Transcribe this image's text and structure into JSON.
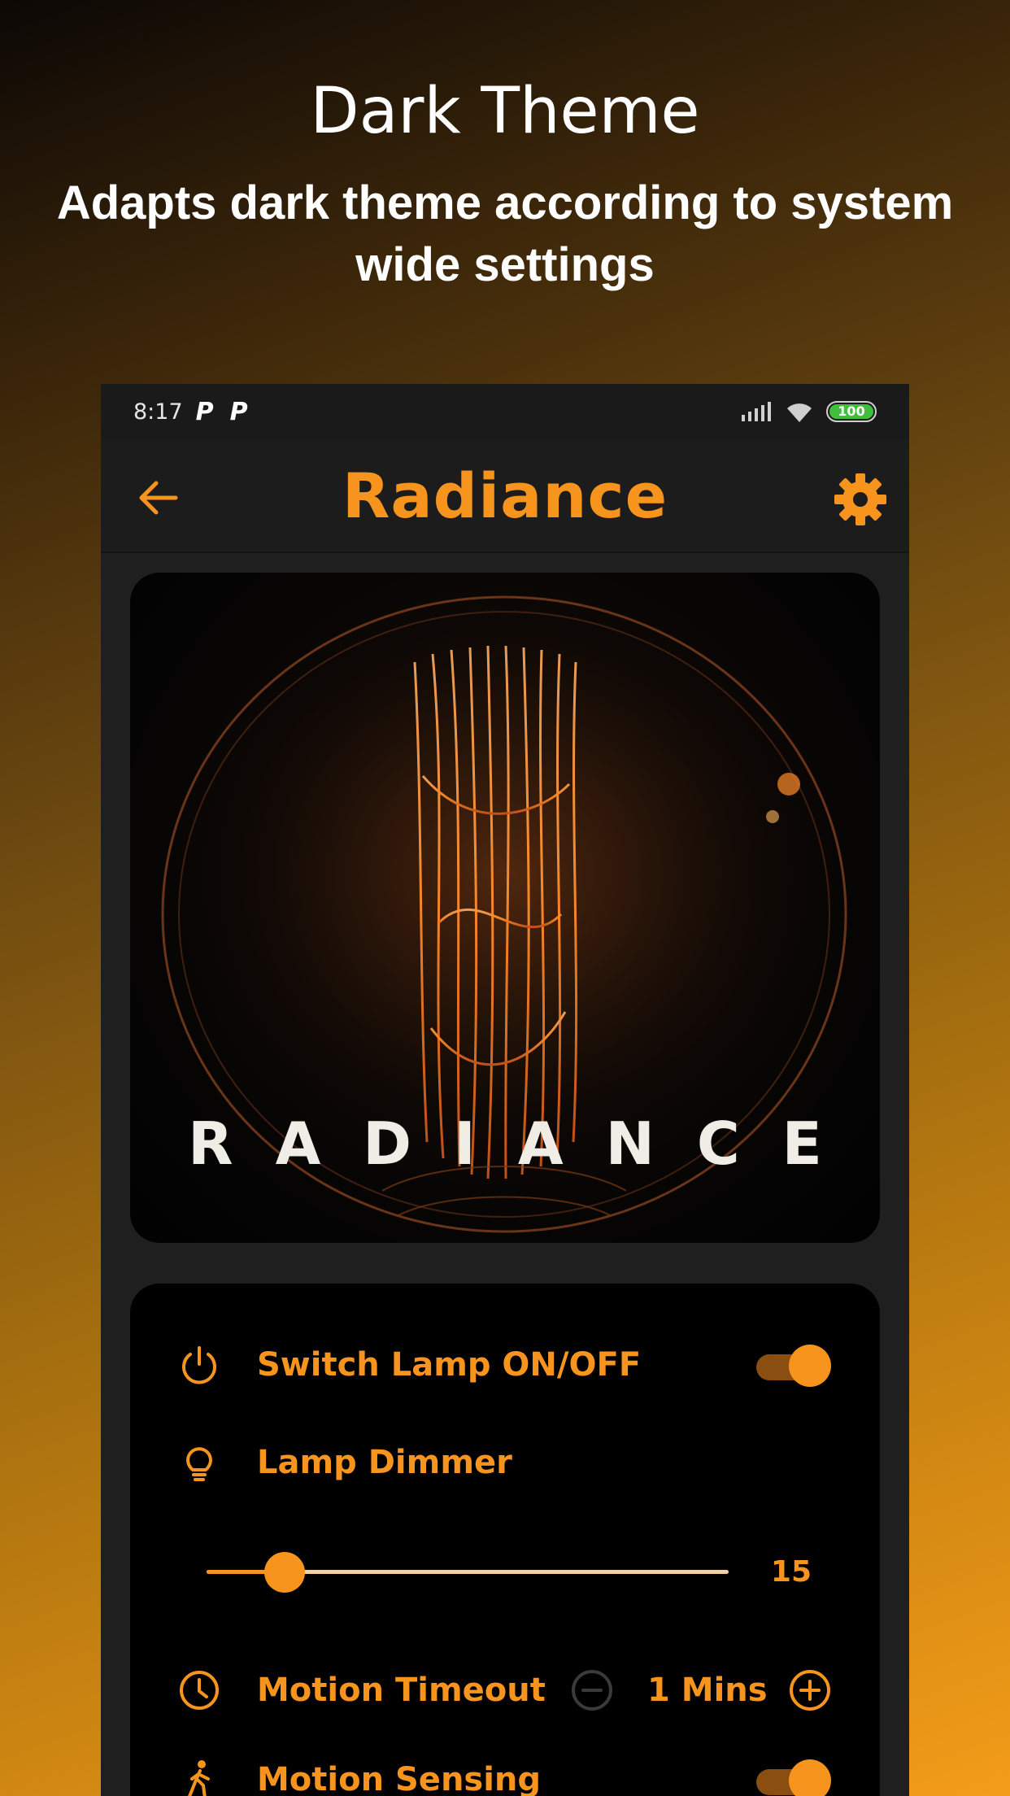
{
  "promo": {
    "title": "Dark Theme",
    "subtitle": "Adapts dark theme according to system wide settings"
  },
  "status_bar": {
    "time": "8:17",
    "notif_1": "P",
    "notif_2": "P",
    "battery": "100",
    "icons": [
      "signal-icon",
      "wifi-icon",
      "battery-icon"
    ]
  },
  "app_bar": {
    "title": "Radiance",
    "back_icon": "arrow-left-icon",
    "settings_icon": "gear-icon"
  },
  "hero": {
    "word": "RADIANCE"
  },
  "controls": {
    "lamp_switch": {
      "label": "Switch Lamp ON/OFF",
      "icon": "power-icon",
      "on": true
    },
    "dimmer": {
      "label": "Lamp Dimmer",
      "icon": "lightbulb-icon",
      "value": "15",
      "fraction": 0.15
    },
    "motion_timeout": {
      "label": "Motion Timeout",
      "icon": "clock-icon",
      "value": "1 Mins"
    },
    "motion_sensing": {
      "label": "Motion Sensing",
      "icon": "walking-icon",
      "on": true
    }
  },
  "colors": {
    "accent": "#f7941d",
    "card": "#000000",
    "app_bg": "#1f1f1f"
  }
}
